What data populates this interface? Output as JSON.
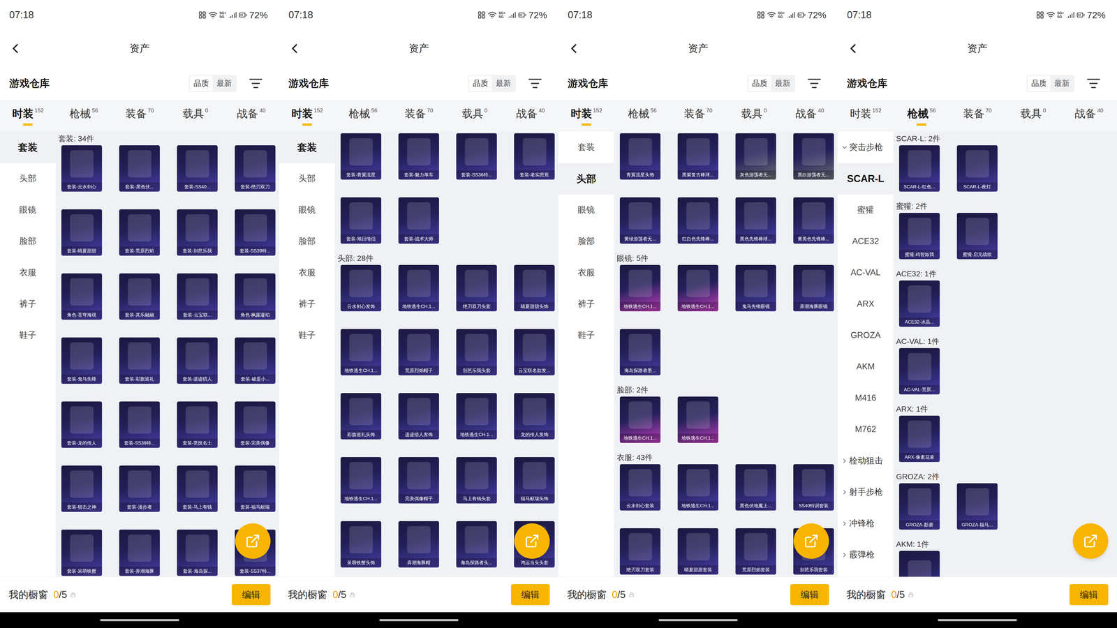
{
  "panels": [
    {
      "status_bar": {
        "time": "07:18",
        "network": [
          "5G+",
          "5G"
        ],
        "battery": "72%"
      },
      "header": {
        "title": "资产"
      },
      "warehouse": {
        "title": "游戏仓库",
        "sort_options": [
          {
            "label": "品质",
            "selected": true
          },
          {
            "label": "最新",
            "selected": false
          }
        ]
      },
      "tabs": [
        {
          "label": "时装",
          "count": "152",
          "selected": true
        },
        {
          "label": "枪械",
          "count": "56",
          "selected": false
        },
        {
          "label": "装备",
          "count": "70",
          "selected": false
        },
        {
          "label": "载具",
          "count": "0",
          "selected": false
        },
        {
          "label": "战备",
          "count": "40",
          "selected": false
        }
      ],
      "sidebar": [
        {
          "label": "套装",
          "kind": "item",
          "selected": true
        },
        {
          "label": "头部",
          "kind": "item",
          "selected": false
        },
        {
          "label": "眼镜",
          "kind": "item",
          "selected": false
        },
        {
          "label": "脸部",
          "kind": "item",
          "selected": false
        },
        {
          "label": "衣服",
          "kind": "item",
          "selected": false
        },
        {
          "label": "裤子",
          "kind": "item",
          "selected": false
        },
        {
          "label": "鞋子",
          "kind": "item",
          "selected": false
        }
      ],
      "sections": [
        {
          "label": "套装: 34件",
          "items": [
            {
              "label": "套装-云水剑心",
              "color": "#4a3fa8"
            },
            {
              "label": "套装-黑色伏...",
              "color": "#4a3fa8"
            },
            {
              "label": "套装-SS40...",
              "color": "#4a3fa8"
            },
            {
              "label": "套装-绝刃双刀",
              "color": "#4a3fa8"
            },
            {
              "label": "套装-晴夏甜甜",
              "color": "#4a3fa8"
            },
            {
              "label": "套装-荒原烈焰",
              "color": "#4a3fa8"
            },
            {
              "label": "套装-别芭乐我",
              "color": "#4a3fa8"
            },
            {
              "label": "套装-SS39特...",
              "color": "#4a3fa8"
            },
            {
              "label": "角色-苍穹海境",
              "color": "#4a3fa8"
            },
            {
              "label": "套装-其乐融融",
              "color": "#4a3fa8"
            },
            {
              "label": "套装-云宝联...",
              "color": "#4a3fa8"
            },
            {
              "label": "角色-枫露凝珀",
              "color": "#4a3fa8"
            },
            {
              "label": "套装-鬼马先锋",
              "color": "#4a3fa8"
            },
            {
              "label": "套装-彩旗巡礼",
              "color": "#4a3fa8"
            },
            {
              "label": "套装-遗迹猎人",
              "color": "#4a3fa8"
            },
            {
              "label": "套装-破蛋小...",
              "color": "#4a3fa8"
            },
            {
              "label": "套装-龙的传人",
              "color": "#4a3fa8"
            },
            {
              "label": "套装-SS38特...",
              "color": "#4a3fa8"
            },
            {
              "label": "套装-竞技名士",
              "color": "#4a3fa8"
            },
            {
              "label": "套装-完美偶像",
              "color": "#4a3fa8"
            },
            {
              "label": "套装-狙击之神",
              "color": "#4a3fa8"
            },
            {
              "label": "套装-漫步者",
              "color": "#4a3fa8"
            },
            {
              "label": "套装-马上有钱",
              "color": "#4a3fa8"
            },
            {
              "label": "套装-福马献瑞",
              "color": "#4a3fa8"
            },
            {
              "label": "套装-呆萌铁蟹",
              "color": "#4a3fa8"
            },
            {
              "label": "套装-弄潮海豚",
              "color": "#4a3fa8"
            },
            {
              "label": "套装-海岛探...",
              "color": "#4a3fa8"
            },
            {
              "label": "套装-SS37特...",
              "color": "#4a3fa8"
            }
          ]
        }
      ],
      "showcase": {
        "label": "我的橱窗",
        "count": "0",
        "total": "/5",
        "button": "编辑"
      }
    },
    {
      "status_bar": {
        "time": "07:18",
        "network": [
          "5G+",
          "5G"
        ],
        "battery": "72%"
      },
      "header": {
        "title": "资产"
      },
      "warehouse": {
        "title": "游戏仓库",
        "sort_options": [
          {
            "label": "品质",
            "selected": true
          },
          {
            "label": "最新",
            "selected": false
          }
        ]
      },
      "tabs": [
        {
          "label": "时装",
          "count": "152",
          "selected": true
        },
        {
          "label": "枪械",
          "count": "56",
          "selected": false
        },
        {
          "label": "装备",
          "count": "70",
          "selected": false
        },
        {
          "label": "载具",
          "count": "0",
          "selected": false
        },
        {
          "label": "战备",
          "count": "40",
          "selected": false
        }
      ],
      "sidebar": [
        {
          "label": "套装",
          "kind": "item",
          "selected": true
        },
        {
          "label": "头部",
          "kind": "item",
          "selected": false
        },
        {
          "label": "眼镜",
          "kind": "item",
          "selected": false
        },
        {
          "label": "脸部",
          "kind": "item",
          "selected": false
        },
        {
          "label": "衣服",
          "kind": "item",
          "selected": false
        },
        {
          "label": "裤子",
          "kind": "item",
          "selected": false
        },
        {
          "label": "鞋子",
          "kind": "item",
          "selected": false
        }
      ],
      "sections": [
        {
          "items": [
            {
              "label": "套装-青翼流星",
              "color": "#4a3fa8"
            },
            {
              "label": "套装-魅力单车",
              "color": "#4a3fa8"
            },
            {
              "label": "套装-SS36特...",
              "color": "#4a3fa8"
            },
            {
              "label": "套装-老实芭蕉",
              "color": "#4a3fa8"
            },
            {
              "label": "套装-旭日情侣",
              "color": "#4a3fa8"
            },
            {
              "label": "套装-战术大师",
              "color": "#4a3fa8"
            }
          ]
        },
        {
          "label": "头部: 28件",
          "items": [
            {
              "label": "云水剑心发饰",
              "color": "#4a3fa8"
            },
            {
              "label": "地铁逃生CH.1...",
              "color": "#4a3fa8"
            },
            {
              "label": "绝刃双刀头套",
              "color": "#4a3fa8"
            },
            {
              "label": "晴夏甜甜头饰",
              "color": "#4a3fa8"
            },
            {
              "label": "地铁逃生CH.1...",
              "color": "#4a3fa8"
            },
            {
              "label": "荒原烈焰帽子",
              "color": "#4a3fa8"
            },
            {
              "label": "别芭乐我头套",
              "color": "#4a3fa8"
            },
            {
              "label": "云宝联名款发...",
              "color": "#4a3fa8"
            },
            {
              "label": "彩旗巡礼头饰",
              "color": "#4a3fa8"
            },
            {
              "label": "遗迹猎人发饰",
              "color": "#4a3fa8"
            },
            {
              "label": "地铁逃生CH.1...",
              "color": "#4a3fa8"
            },
            {
              "label": "龙的传人发饰",
              "color": "#4a3fa8"
            },
            {
              "label": "地铁逃生CH.1...",
              "color": "#4a3fa8"
            },
            {
              "label": "完美偶像帽子",
              "color": "#4a3fa8"
            },
            {
              "label": "马上有钱头套",
              "color": "#4a3fa8"
            },
            {
              "label": "福马献瑞头饰",
              "color": "#4a3fa8"
            },
            {
              "label": "呆萌铁蟹头饰",
              "color": "#4a3fa8"
            },
            {
              "label": "弄潮海豚帽",
              "color": "#4a3fa8"
            },
            {
              "label": "海岛探路者头...",
              "color": "#4a3fa8"
            },
            {
              "label": "鸿运当头头套",
              "color": "#4a3fa8"
            }
          ]
        }
      ],
      "showcase": {
        "label": "我的橱窗",
        "count": "0",
        "total": "/5",
        "button": "编辑"
      }
    },
    {
      "status_bar": {
        "time": "07:18",
        "network": [
          "5G+",
          "5G"
        ],
        "battery": "72%"
      },
      "header": {
        "title": "资产"
      },
      "warehouse": {
        "title": "游戏仓库",
        "sort_options": [
          {
            "label": "品质",
            "selected": true
          },
          {
            "label": "最新",
            "selected": false
          }
        ]
      },
      "tabs": [
        {
          "label": "时装",
          "count": "152",
          "selected": true
        },
        {
          "label": "枪械",
          "count": "56",
          "selected": false
        },
        {
          "label": "装备",
          "count": "70",
          "selected": false
        },
        {
          "label": "载具",
          "count": "0",
          "selected": false
        },
        {
          "label": "战备",
          "count": "40",
          "selected": false
        }
      ],
      "sidebar": [
        {
          "label": "套装",
          "kind": "item",
          "selected": false
        },
        {
          "label": "头部",
          "kind": "item",
          "selected": true
        },
        {
          "label": "眼镜",
          "kind": "item",
          "selected": false
        },
        {
          "label": "脸部",
          "kind": "item",
          "selected": false
        },
        {
          "label": "衣服",
          "kind": "item",
          "selected": false
        },
        {
          "label": "裤子",
          "kind": "item",
          "selected": false
        },
        {
          "label": "鞋子",
          "kind": "item",
          "selected": false
        }
      ],
      "sections": [
        {
          "items": [
            {
              "label": "青翼流星头饰",
              "color": "#4a3fa8"
            },
            {
              "label": "黑紫复古棒球...",
              "color": "#4a3fa8"
            },
            {
              "label": "灰色游荡者无...",
              "color": "#6b6e78"
            },
            {
              "label": "黑白游荡者无...",
              "color": "#6b6e78"
            },
            {
              "label": "黄绿游荡者无...",
              "color": "#4a3fa8"
            },
            {
              "label": "红白色先锋棒...",
              "color": "#4a3fa8"
            },
            {
              "label": "黑色先锋棒球...",
              "color": "#4a3fa8"
            },
            {
              "label": "黄黑色先锋棒...",
              "color": "#4a3fa8"
            }
          ]
        },
        {
          "label": "眼镜: 5件",
          "items": [
            {
              "label": "地铁逃生CH.1...",
              "color": "#c03fbf"
            },
            {
              "label": "地铁逃生CH.1...",
              "color": "#c03fbf"
            },
            {
              "label": "鬼马先锋眼镜",
              "color": "#4a3fa8"
            },
            {
              "label": "弄潮海豚眼镜",
              "color": "#4a3fa8"
            },
            {
              "label": "海岛探路者墨...",
              "color": "#4a3fa8"
            }
          ]
        },
        {
          "label": "脸部: 2件",
          "items": [
            {
              "label": "地铁逃生CH.1...",
              "color": "#c03fbf"
            },
            {
              "label": "地铁逃生CH.1...",
              "color": "#c03fbf"
            }
          ]
        },
        {
          "label": "衣服: 43件",
          "items": [
            {
              "label": "云水剑心套装",
              "color": "#4a3fa8"
            },
            {
              "label": "地铁逃生CH.1...",
              "color": "#4a3fa8"
            },
            {
              "label": "黑色伏地魔上...",
              "color": "#4a3fa8"
            },
            {
              "label": "SS40特训套装",
              "color": "#4a3fa8"
            },
            {
              "label": "绝刃双刀套装",
              "color": "#4a3fa8"
            },
            {
              "label": "晴夏甜甜套装",
              "color": "#4a3fa8"
            },
            {
              "label": "荒原烈焰套装",
              "color": "#4a3fa8"
            },
            {
              "label": "别芭乐我套装",
              "color": "#4a3fa8"
            }
          ]
        }
      ],
      "showcase": {
        "label": "我的橱窗",
        "count": "0",
        "total": "/5",
        "button": "编辑"
      }
    },
    {
      "status_bar": {
        "time": "07:18",
        "network": [
          "5G+",
          "5G"
        ],
        "battery": "72%"
      },
      "header": {
        "title": "资产"
      },
      "warehouse": {
        "title": "游戏仓库",
        "sort_options": [
          {
            "label": "品质",
            "selected": true
          },
          {
            "label": "最新",
            "selected": false
          }
        ]
      },
      "tabs": [
        {
          "label": "时装",
          "count": "152",
          "selected": false
        },
        {
          "label": "枪械",
          "count": "56",
          "selected": true
        },
        {
          "label": "装备",
          "count": "70",
          "selected": false
        },
        {
          "label": "载具",
          "count": "0",
          "selected": false
        },
        {
          "label": "战备",
          "count": "40",
          "selected": false
        }
      ],
      "sidebar": [
        {
          "label": "突击步枪",
          "kind": "group",
          "expanded": true,
          "selected": false
        },
        {
          "label": "SCAR-L",
          "kind": "item",
          "selected": true
        },
        {
          "label": "蜜獾",
          "kind": "item",
          "selected": false
        },
        {
          "label": "ACE32",
          "kind": "item",
          "selected": false
        },
        {
          "label": "AC-VAL",
          "kind": "item",
          "selected": false
        },
        {
          "label": "ARX",
          "kind": "item",
          "selected": false
        },
        {
          "label": "GROZA",
          "kind": "item",
          "selected": false
        },
        {
          "label": "AKM",
          "kind": "item",
          "selected": false
        },
        {
          "label": "M416",
          "kind": "item",
          "selected": false
        },
        {
          "label": "M762",
          "kind": "item",
          "selected": false
        },
        {
          "label": "栓动狙击",
          "kind": "group",
          "expanded": false,
          "selected": false
        },
        {
          "label": "射手步枪",
          "kind": "group",
          "expanded": false,
          "selected": false
        },
        {
          "label": "冲锋枪",
          "kind": "group",
          "expanded": false,
          "selected": false
        },
        {
          "label": "霰弹枪",
          "kind": "group",
          "expanded": false,
          "selected": false
        }
      ],
      "sections": [
        {
          "label": "SCAR-L: 2件",
          "items": [
            {
              "label": "SCAR-L-红色...",
              "color": "#4a3fa8"
            },
            {
              "label": "SCAR-L-夜灯",
              "color": "#4a3fa8"
            }
          ]
        },
        {
          "label": "蜜獾: 2件",
          "items": [
            {
              "label": "蜜獾-鸡智如我",
              "color": "#4a3fa8"
            },
            {
              "label": "蜜獾-启元战纹",
              "color": "#4a3fa8"
            }
          ]
        },
        {
          "label": "ACE32: 1件",
          "items": [
            {
              "label": "ACE32-冰晶...",
              "color": "#4a3fa8"
            }
          ]
        },
        {
          "label": "AC-VAL: 1件",
          "items": [
            {
              "label": "AC-VAL-荒原...",
              "color": "#4a3fa8"
            }
          ]
        },
        {
          "label": "ARX: 1件",
          "items": [
            {
              "label": "ARX-像素花束",
              "color": "#4a3fa8"
            }
          ]
        },
        {
          "label": "GROZA: 2件",
          "items": [
            {
              "label": "GROZA-影袭",
              "color": "#4a3fa8"
            },
            {
              "label": "GROZA-福马...",
              "color": "#4a3fa8"
            }
          ]
        },
        {
          "label": "AKM: 1件",
          "items": [
            {
              "color": "#4a3fa8"
            }
          ]
        }
      ],
      "showcase": {
        "label": "我的橱窗",
        "count": "0",
        "total": "/5",
        "button": "编辑"
      }
    }
  ]
}
